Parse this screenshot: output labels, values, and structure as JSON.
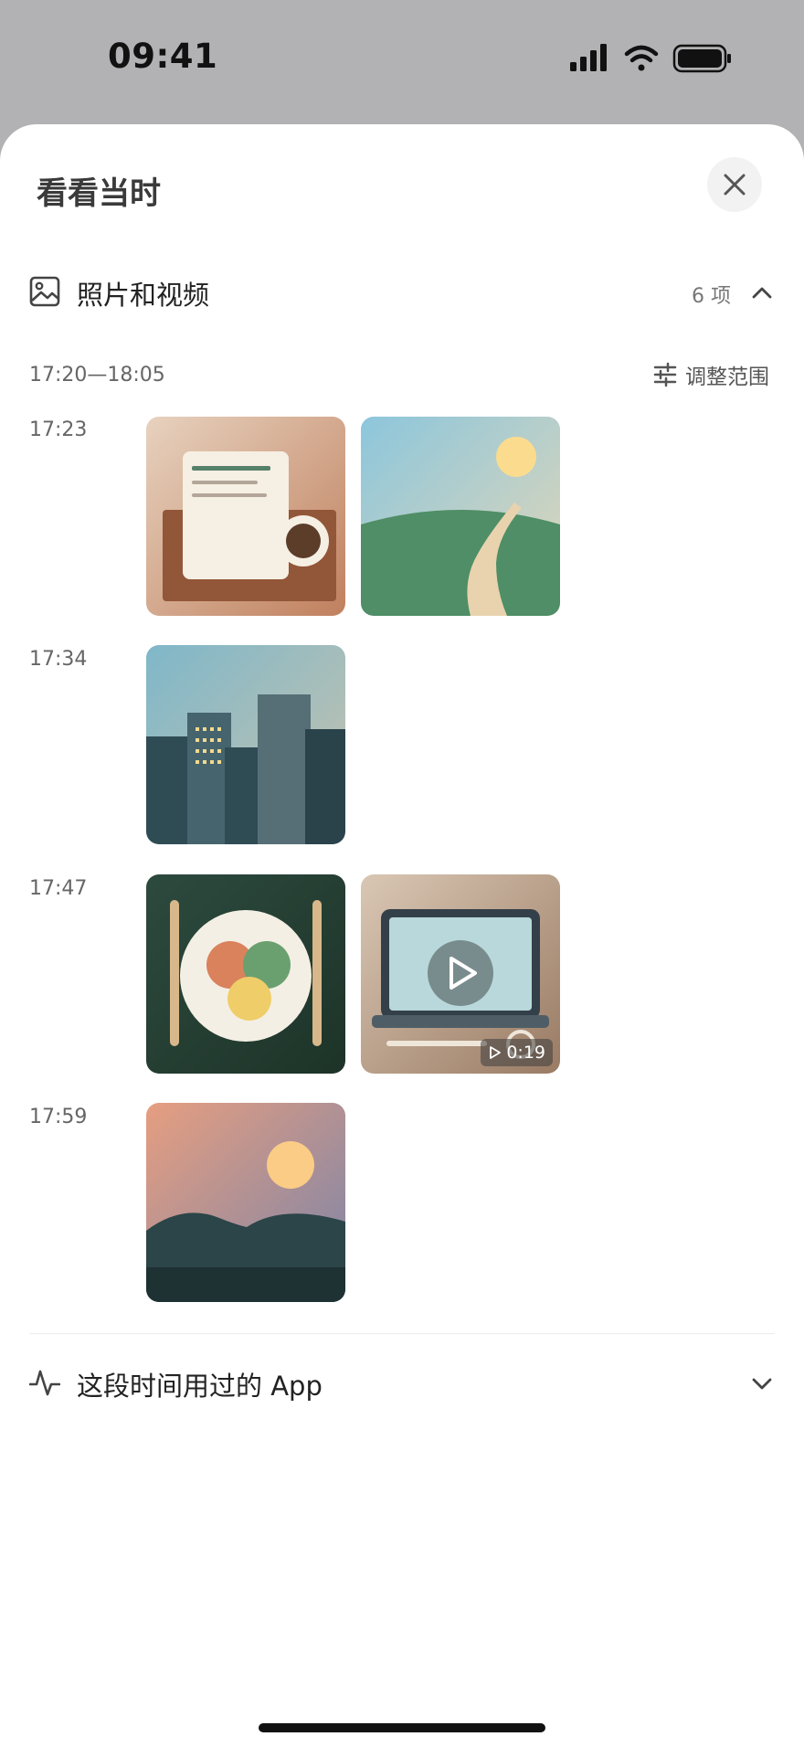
{
  "status_bar": {
    "time": "09:41"
  },
  "sheet": {
    "title": "看看当时",
    "photos_section": {
      "label": "照片和视频",
      "count": "6 项"
    },
    "range": {
      "text": "17:20—18:05",
      "adjust_label": "调整范围"
    },
    "rows": [
      {
        "time": "17:23"
      },
      {
        "time": "17:34"
      },
      {
        "time": "17:47"
      },
      {
        "time": "17:59"
      }
    ],
    "video": {
      "duration": "0:19"
    },
    "apps_section": {
      "label": "这段时间用过的 App"
    }
  },
  "icons": {
    "close": "close-icon",
    "photos": "photo-icon",
    "chevron_up": "chevron-up-icon",
    "chevron_down": "chevron-down-icon",
    "adjust": "sliders-icon",
    "activity": "activity-icon",
    "play": "play-icon"
  }
}
